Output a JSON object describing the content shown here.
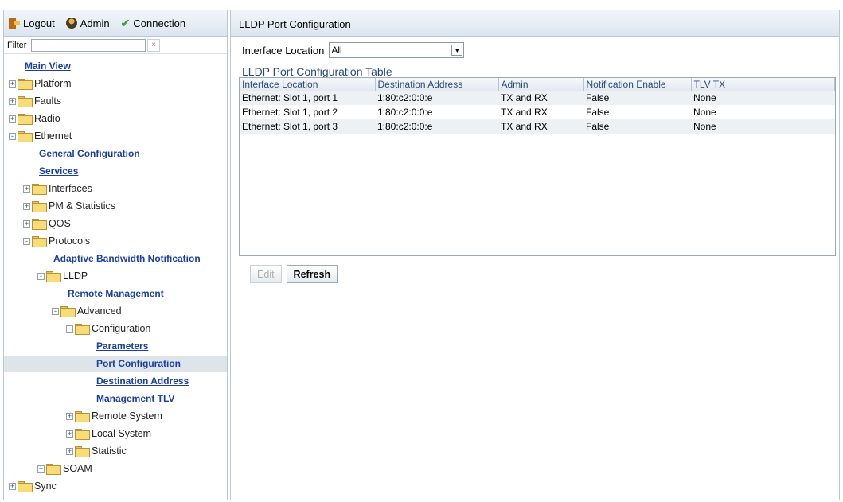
{
  "toolbar": {
    "logout": "Logout",
    "admin": "Admin",
    "connection": "Connection"
  },
  "filter": {
    "label": "Filter",
    "value": "",
    "clear": "×"
  },
  "tree": [
    {
      "label": "Main View",
      "link": true,
      "indent": 0,
      "toggle": null
    },
    {
      "label": "Platform",
      "indent": 0,
      "toggle": "+"
    },
    {
      "label": "Faults",
      "indent": 0,
      "toggle": "+"
    },
    {
      "label": "Radio",
      "indent": 0,
      "toggle": "+"
    },
    {
      "label": "Ethernet",
      "indent": 0,
      "toggle": "-"
    },
    {
      "label": "General Configuration",
      "link": true,
      "indent": 1,
      "toggle": null
    },
    {
      "label": "Services",
      "link": true,
      "indent": 1,
      "toggle": null
    },
    {
      "label": "Interfaces",
      "indent": 1,
      "toggle": "+"
    },
    {
      "label": "PM & Statistics",
      "indent": 1,
      "toggle": "+"
    },
    {
      "label": "QOS",
      "indent": 1,
      "toggle": "+"
    },
    {
      "label": "Protocols",
      "indent": 1,
      "toggle": "-"
    },
    {
      "label": "Adaptive Bandwidth Notification",
      "link": true,
      "indent": 2,
      "toggle": null
    },
    {
      "label": "LLDP",
      "indent": 2,
      "toggle": "-"
    },
    {
      "label": "Remote Management",
      "link": true,
      "indent": 3,
      "toggle": null
    },
    {
      "label": "Advanced",
      "indent": 3,
      "toggle": "-"
    },
    {
      "label": "Configuration",
      "indent": 4,
      "toggle": "-"
    },
    {
      "label": "Parameters",
      "link": true,
      "indent": 5,
      "toggle": null
    },
    {
      "label": "Port Configuration",
      "link": true,
      "indent": 5,
      "toggle": null,
      "selected": true
    },
    {
      "label": "Destination Address",
      "link": true,
      "indent": 5,
      "toggle": null
    },
    {
      "label": "Management TLV",
      "link": true,
      "indent": 5,
      "toggle": null
    },
    {
      "label": "Remote System",
      "indent": 4,
      "toggle": "+"
    },
    {
      "label": "Local System",
      "indent": 4,
      "toggle": "+"
    },
    {
      "label": "Statistic",
      "indent": 4,
      "toggle": "+"
    },
    {
      "label": "SOAM",
      "indent": 2,
      "toggle": "+"
    },
    {
      "label": "Sync",
      "indent": 0,
      "toggle": "+"
    }
  ],
  "main": {
    "title": "LLDP Port Configuration",
    "interface_label": "Interface Location",
    "interface_value": "All",
    "table_title": "LLDP Port Configuration Table",
    "columns": [
      "Interface Location",
      "Destination Address",
      "Admin",
      "Notification Enable",
      "TLV TX"
    ],
    "rows": [
      [
        "Ethernet: Slot 1, port 1",
        "1:80:c2:0:0:e",
        "TX and RX",
        "False",
        "None"
      ],
      [
        "Ethernet: Slot 1, port 2",
        "1:80:c2:0:0:e",
        "TX and RX",
        "False",
        "None"
      ],
      [
        "Ethernet: Slot 1, port 3",
        "1:80:c2:0:0:e",
        "TX and RX",
        "False",
        "None"
      ]
    ],
    "edit_label": "Edit",
    "refresh_label": "Refresh"
  }
}
